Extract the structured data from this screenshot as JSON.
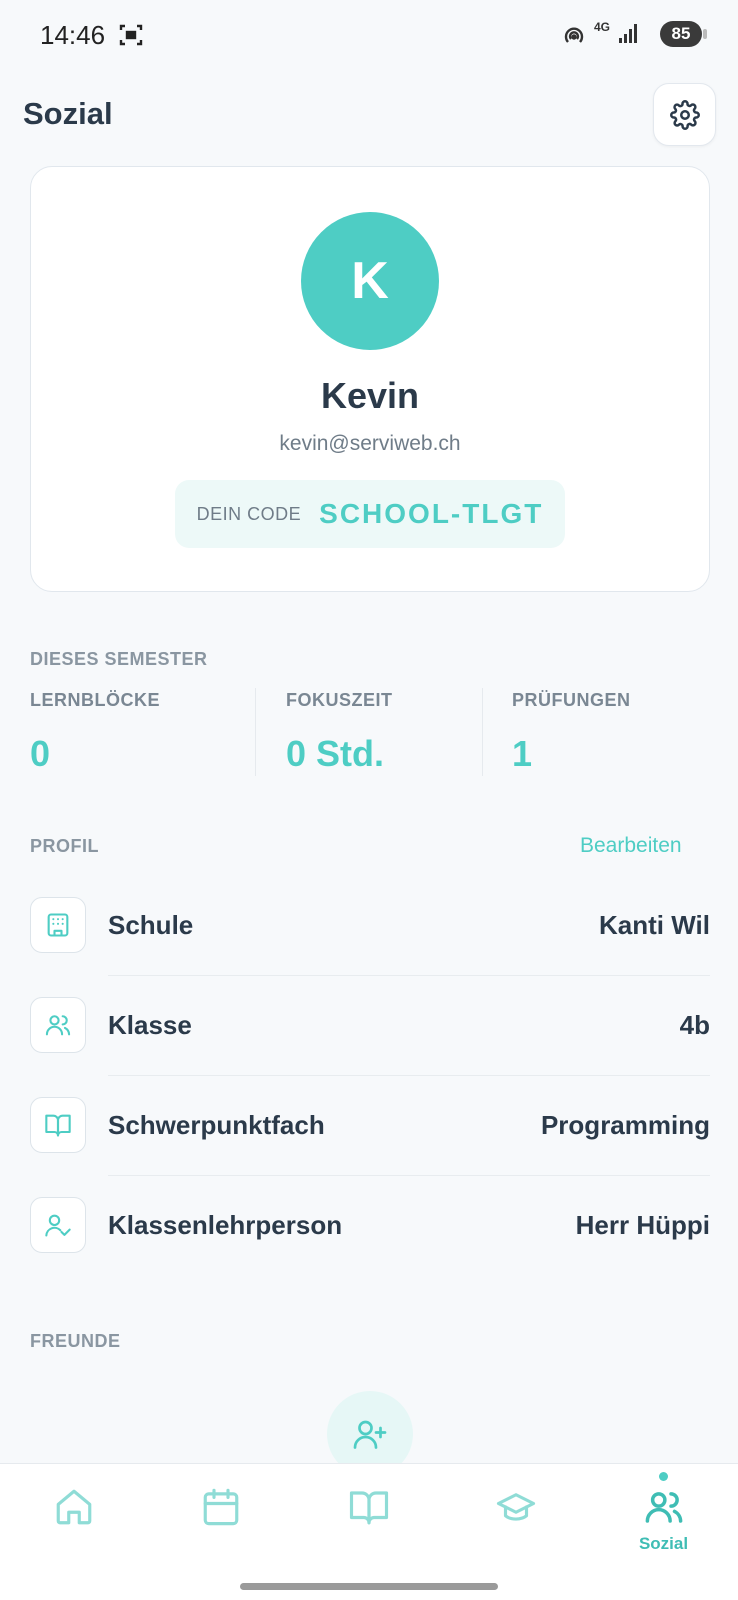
{
  "status_bar": {
    "time": "14:46",
    "battery": "85",
    "network": "4G"
  },
  "header": {
    "title": "Sozial"
  },
  "profile": {
    "avatar_initial": "K",
    "name": "Kevin",
    "email": "kevin@serviweb.ch",
    "code_label": "DEIN CODE",
    "code_value": "SCHOOL-TLGT"
  },
  "semester": {
    "section_label": "DIESES SEMESTER",
    "stats": [
      {
        "label": "LERNBLÖCKE",
        "value": "0"
      },
      {
        "label": "FOKUSZEIT",
        "value": "0 Std."
      },
      {
        "label": "PRÜFUNGEN",
        "value": "1"
      }
    ]
  },
  "profil_section": {
    "section_label": "PROFIL",
    "edit_label": "Bearbeiten",
    "rows": [
      {
        "label": "Schule",
        "value": "Kanti Wil",
        "icon": "building-icon"
      },
      {
        "label": "Klasse",
        "value": "4b",
        "icon": "users-icon"
      },
      {
        "label": "Schwerpunktfach",
        "value": "Programming",
        "icon": "book-icon"
      },
      {
        "label": "Klassenlehrperson",
        "value": "Herr Hüppi",
        "icon": "user-check-icon"
      }
    ]
  },
  "friends": {
    "section_label": "FREUNDE"
  },
  "bottom_nav": {
    "items": [
      {
        "icon": "home-icon",
        "label": ""
      },
      {
        "icon": "calendar-icon",
        "label": ""
      },
      {
        "icon": "book-open-icon",
        "label": ""
      },
      {
        "icon": "graduation-cap-icon",
        "label": ""
      },
      {
        "icon": "users-icon",
        "label": "Sozial",
        "active": true
      }
    ]
  },
  "colors": {
    "accent": "#4ecdc4",
    "text": "#2b3a4a",
    "muted": "#8a96a1",
    "background": "#f7f9fb"
  }
}
